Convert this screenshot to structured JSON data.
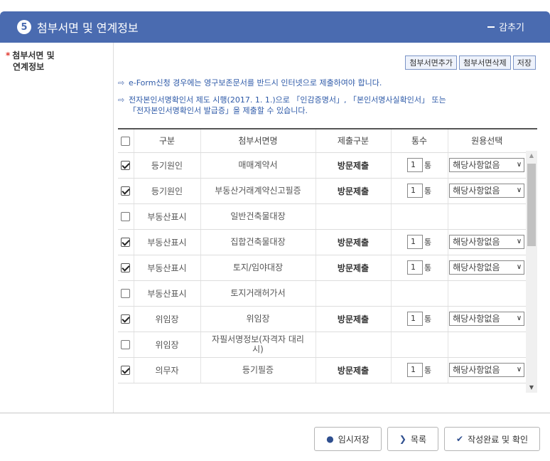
{
  "header": {
    "step_number": "5",
    "title": "첨부서면 및 연계정보",
    "collapse_label": "감추기"
  },
  "field_label": {
    "required_mark": "*",
    "line1": "첨부서면 및",
    "line2": "연계정보"
  },
  "actions": {
    "add": "첨부서면추가",
    "delete": "첨부서면삭제",
    "save": "저장"
  },
  "notices": [
    "e-Form신청 경우에는 영구보존문서를 반드시 인터넷으로 제출하여야 합니다.",
    "전자본인서명확인서 제도 시행(2017. 1. 1.)으로 「인감증명서」, 「본인서명사실확인서」 또는",
    "「전자본인서명확인서 발급증」을 제출할 수 있습니다."
  ],
  "table": {
    "headers": [
      "구분",
      "첨부서면명",
      "제출구분",
      "통수",
      "원용선택"
    ],
    "rows": [
      {
        "checked": true,
        "category": "등기원인",
        "doc": "매매계약서",
        "submit": "방문제출",
        "count": "1",
        "unit": "통",
        "select": "해당사항없음"
      },
      {
        "checked": true,
        "category": "등기원인",
        "doc": "부동산거래계약신고필증",
        "submit": "방문제출",
        "count": "1",
        "unit": "통",
        "select": "해당사항없음"
      },
      {
        "checked": false,
        "category": "부동산표시",
        "doc": "일반건축물대장",
        "submit": "",
        "count": "",
        "unit": "",
        "select": ""
      },
      {
        "checked": true,
        "category": "부동산표시",
        "doc": "집합건축물대장",
        "submit": "방문제출",
        "count": "1",
        "unit": "통",
        "select": "해당사항없음"
      },
      {
        "checked": true,
        "category": "부동산표시",
        "doc": "토지/임야대장",
        "submit": "방문제출",
        "count": "1",
        "unit": "통",
        "select": "해당사항없음"
      },
      {
        "checked": false,
        "category": "부동산표시",
        "doc": "토지거래허가서",
        "submit": "",
        "count": "",
        "unit": "",
        "select": ""
      },
      {
        "checked": true,
        "category": "위임장",
        "doc": "위임장",
        "submit": "방문제출",
        "count": "1",
        "unit": "통",
        "select": "해당사항없음"
      },
      {
        "checked": false,
        "category": "위임장",
        "doc": "자필서명정보(자격자 대리 시)",
        "submit": "",
        "count": "",
        "unit": "",
        "select": ""
      },
      {
        "checked": true,
        "category": "의무자",
        "doc": "등기필증",
        "submit": "방문제출",
        "count": "1",
        "unit": "통",
        "select": "해당사항없음"
      }
    ]
  },
  "footer": {
    "temp_save": "임시저장",
    "list": "목록",
    "complete": "작성완료 및 확인"
  },
  "colors": {
    "header_bg": "#4a6bb0",
    "notice_text": "#2e5aa8",
    "required": "#e0362d"
  }
}
